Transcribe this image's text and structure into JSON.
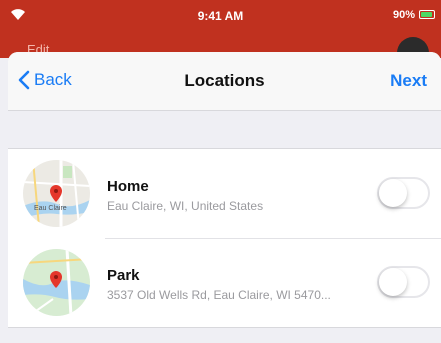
{
  "status_bar": {
    "time": "9:41 AM",
    "battery": "90%",
    "battery_level": 0.9
  },
  "background": {
    "title": "Edit"
  },
  "navbar": {
    "back_label": "Back",
    "title": "Locations",
    "next_label": "Next"
  },
  "colors": {
    "accent": "#1a7cf5",
    "app_red": "#c0311f",
    "pin_red": "#e5372b"
  },
  "locations": [
    {
      "name": "Home",
      "address": "Eau Claire, WI, United States",
      "map_label": "Eau Claire",
      "enabled": false
    },
    {
      "name": "Park",
      "address": "3537 Old Wells Rd, Eau Claire, WI 5470...",
      "enabled": false
    }
  ]
}
